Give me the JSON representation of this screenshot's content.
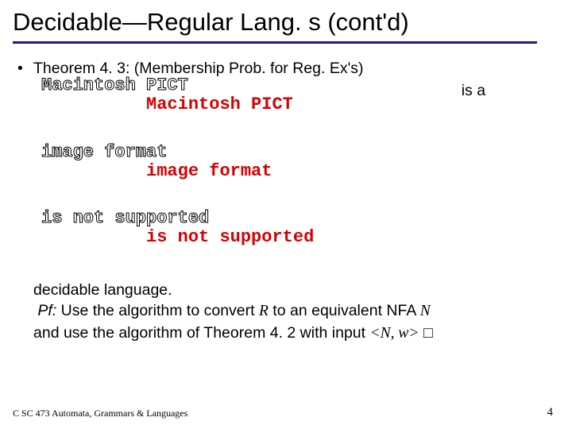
{
  "title": "Decidable—Regular Lang. s (cont'd)",
  "bullet": {
    "marker": "•",
    "line1": "Theorem 4. 3: (Membership Prob. for Reg. Ex's)"
  },
  "pict": {
    "l1": "Macintosh PICT",
    "l2": "image format",
    "l3": "is not supported"
  },
  "isa": "is a",
  "line_decidable": "decidable language.",
  "pf_label": "Pf:",
  "pf_rest1": "  Use the algorithm to convert ",
  "R": "R",
  "pf_rest2": " to an equivalent NFA ",
  "N": "N",
  "line_and": "and use the algorithm of Theorem 4. 2 with input ",
  "nw": "<N, w>",
  "box": " □",
  "footer_left": "C SC 473 Automata, Grammars & Languages",
  "footer_right": "4"
}
